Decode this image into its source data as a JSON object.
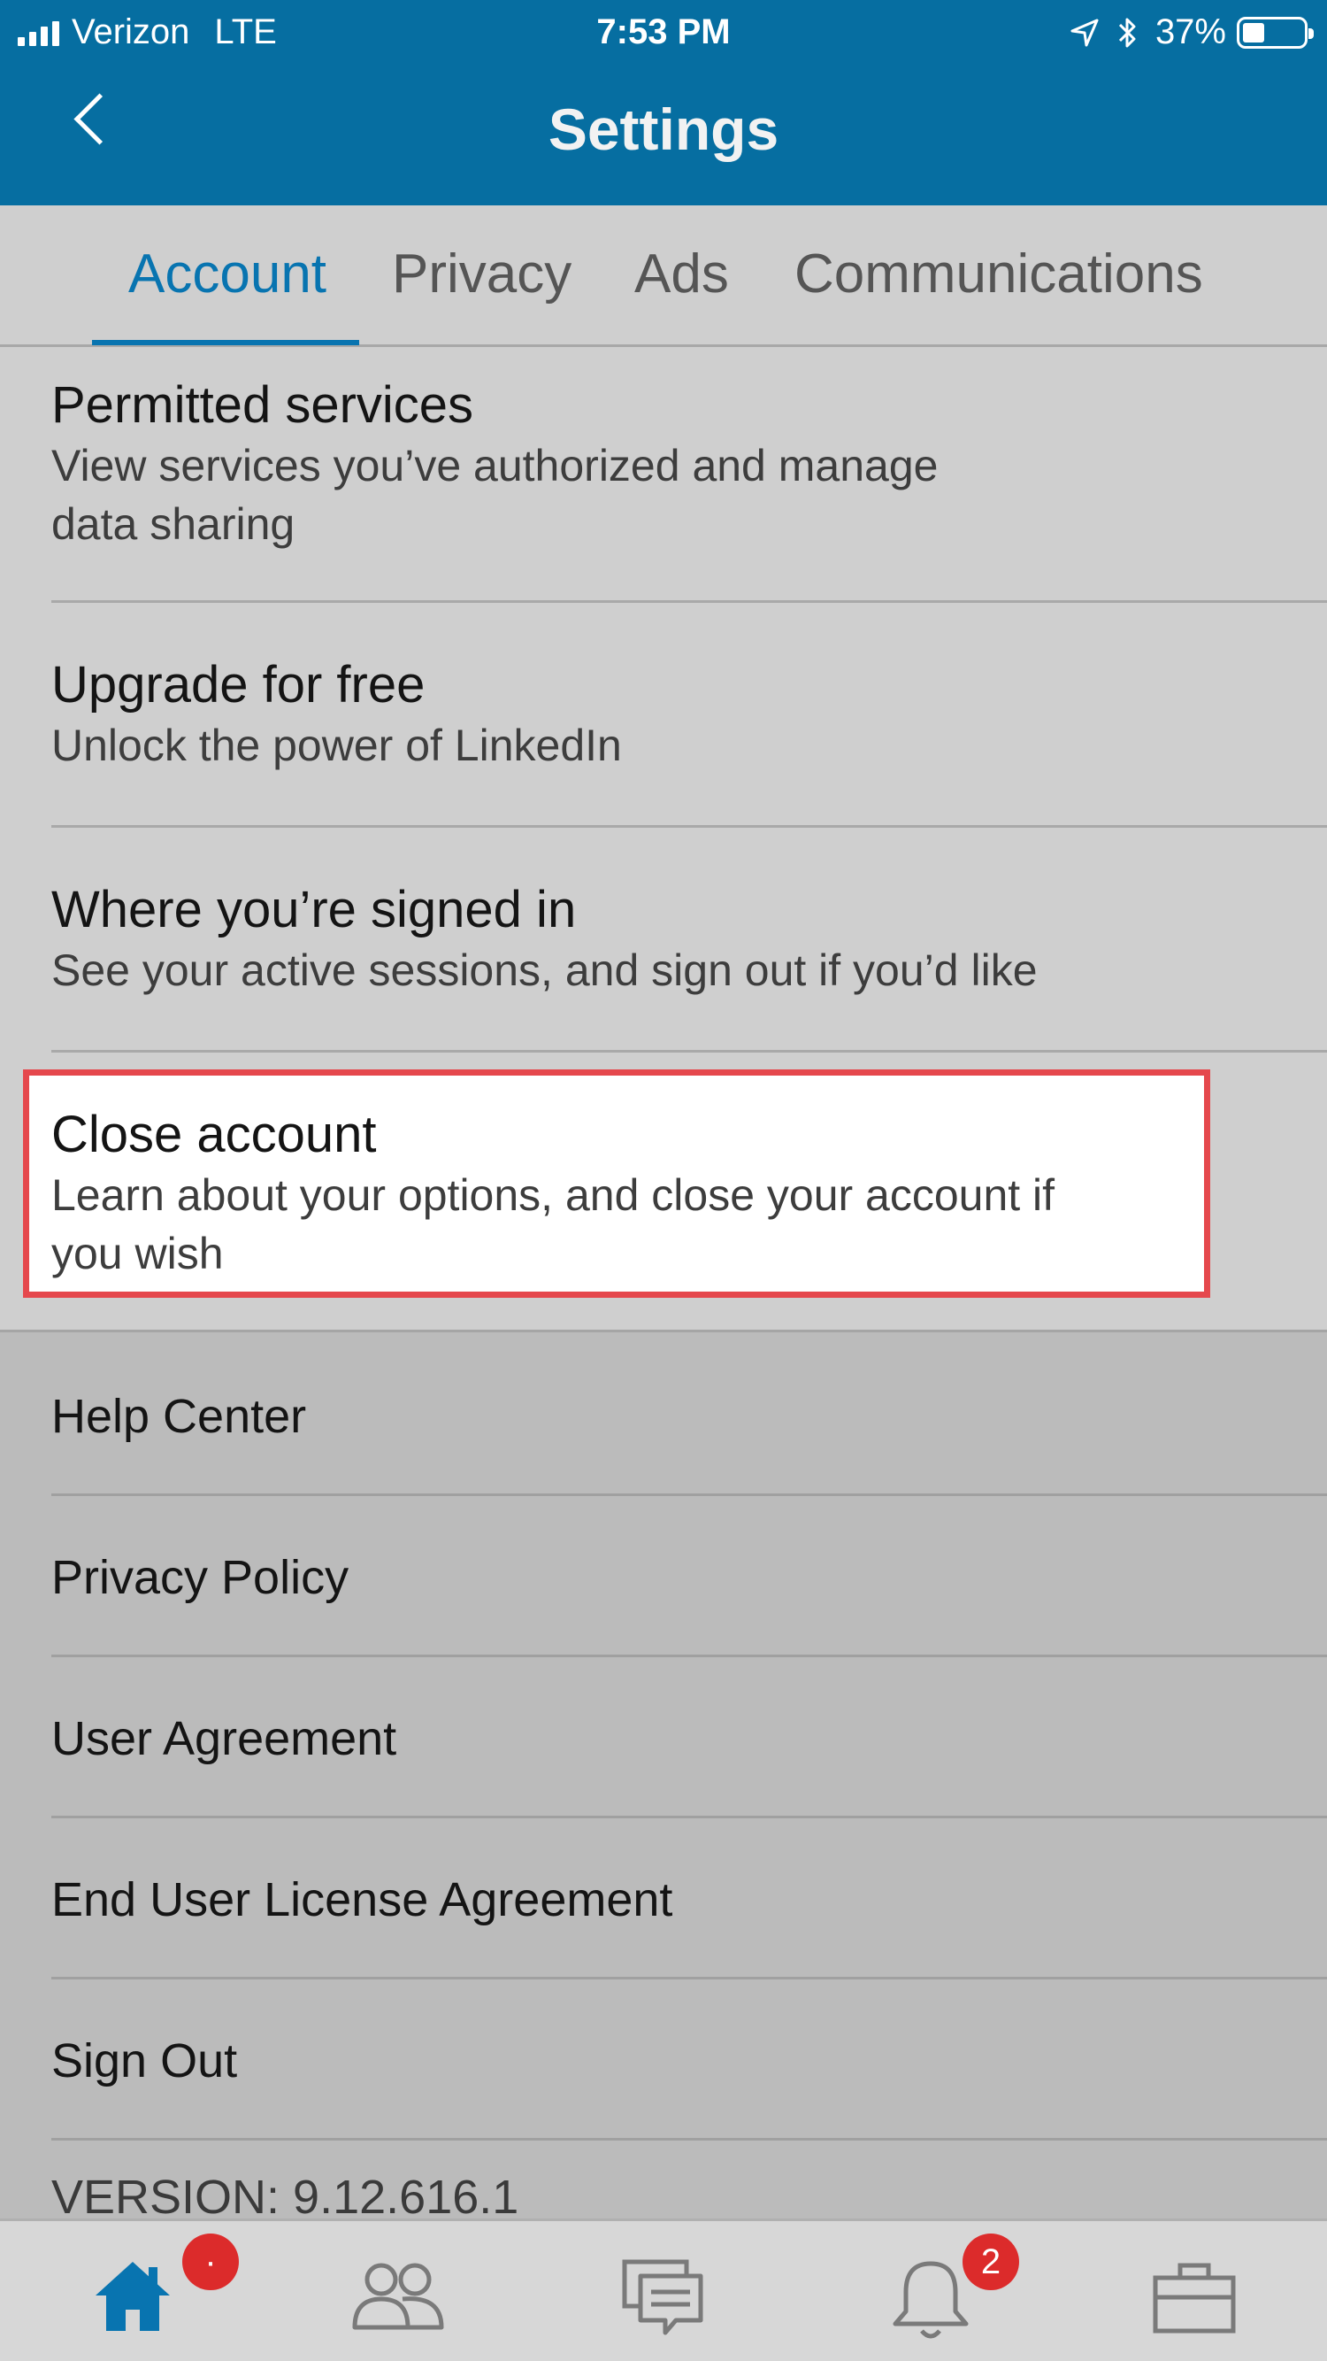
{
  "status_bar": {
    "carrier": "Verizon",
    "network": "LTE",
    "time": "7:53 PM",
    "battery_percent": "37%",
    "battery_level": 0.37
  },
  "header": {
    "title": "Settings"
  },
  "tabs": [
    {
      "label": "Account",
      "active": true
    },
    {
      "label": "Privacy",
      "active": false
    },
    {
      "label": "Ads",
      "active": false
    },
    {
      "label": "Communications",
      "active": false
    }
  ],
  "account_items": [
    {
      "title": "Permitted services",
      "subtitle_lines": [
        "View services you’ve authorized and manage",
        "data sharing"
      ]
    },
    {
      "title": "Upgrade for free",
      "subtitle_lines": [
        "Unlock the power of LinkedIn"
      ]
    },
    {
      "title": "Where you’re signed in",
      "subtitle_lines": [
        "See your active sessions, and sign out if you’d like"
      ]
    },
    {
      "title": "Close account",
      "subtitle_lines": [
        "Learn about your options, and close your account if",
        "you wish"
      ],
      "highlighted": true
    }
  ],
  "links": [
    "Help Center",
    "Privacy Policy",
    "User Agreement",
    "End User License Agreement",
    "Sign Out"
  ],
  "version": "VERSION: 9.12.616.1",
  "bottom_nav": {
    "items": [
      "home-icon",
      "my-network-icon",
      "messaging-icon",
      "notifications-icon",
      "jobs-icon"
    ],
    "home_badge": "·",
    "notifications_badge": "2",
    "active_color": "#0874b0",
    "inactive_color": "#7a7a7a"
  },
  "colors": {
    "header_bg": "#066ea1",
    "accent": "#0874b0",
    "highlight_border": "#e5484d",
    "badge": "#dc2b2b"
  }
}
